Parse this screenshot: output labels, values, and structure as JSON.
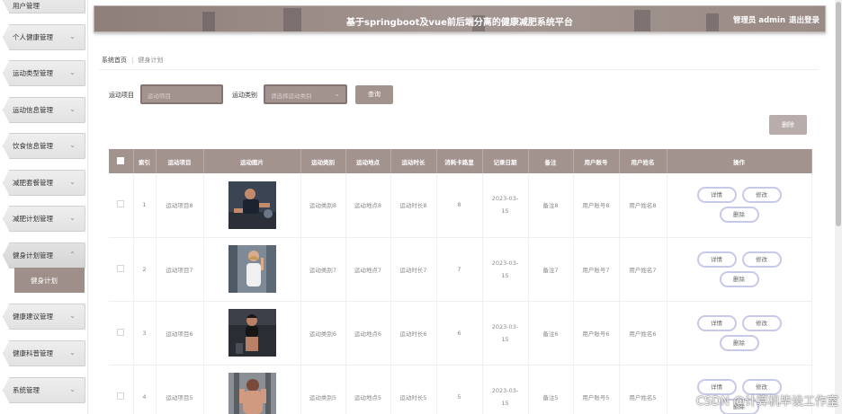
{
  "header": {
    "title": "基于springboot及vue前后端分离的健康减肥系统平台",
    "user": "管理员 admin",
    "logout": "退出登录"
  },
  "sidebar": {
    "items": [
      {
        "label": "用户管理"
      },
      {
        "label": "个人健康管理"
      },
      {
        "label": "运动类型管理"
      },
      {
        "label": "运动信息管理"
      },
      {
        "label": "饮食信息管理"
      },
      {
        "label": "减肥套餐管理"
      },
      {
        "label": "减肥计划管理"
      },
      {
        "label": "健身计划管理"
      },
      {
        "label": "健康建议管理"
      },
      {
        "label": "健康科普管理"
      },
      {
        "label": "系统管理"
      }
    ],
    "submenu": "健身计划"
  },
  "breadcrumb": {
    "home": "系统首页",
    "current": "健身计划"
  },
  "search": {
    "item_label": "运动项目",
    "item_placeholder": "运动项目",
    "type_label": "运动类别",
    "type_placeholder": "请选择运动类别",
    "query_button": "查询"
  },
  "toolbar": {
    "delete_button": "删除"
  },
  "table": {
    "columns": [
      "索引",
      "运动项目",
      "运动图片",
      "运动类别",
      "运动地点",
      "运动时长",
      "消耗卡路里",
      "记录日期",
      "备注",
      "用户账号",
      "用户姓名",
      "操作"
    ],
    "rows": [
      {
        "index": "1",
        "item": "运动项目8",
        "type": "运动类别8",
        "place": "运动地点8",
        "duration": "运动时长8",
        "calories": "8",
        "date": "2023-03-15",
        "note": "备注8",
        "account": "用户账号8",
        "name": "用户姓名8"
      },
      {
        "index": "2",
        "item": "运动项目7",
        "type": "运动类别7",
        "place": "运动地点7",
        "duration": "运动时长7",
        "calories": "7",
        "date": "2023-03-15",
        "note": "备注7",
        "account": "用户账号7",
        "name": "用户姓名7"
      },
      {
        "index": "3",
        "item": "运动项目6",
        "type": "运动类别6",
        "place": "运动地点6",
        "duration": "运动时长6",
        "calories": "6",
        "date": "2023-03-15",
        "note": "备注6",
        "account": "用户账号6",
        "name": "用户姓名6"
      },
      {
        "index": "4",
        "item": "运动项目5",
        "type": "运动类别5",
        "place": "运动地点5",
        "duration": "运动时长5",
        "calories": "5",
        "date": "2023-03-15",
        "note": "备注5",
        "account": "用户账号5",
        "name": "用户姓名5"
      }
    ],
    "actions": {
      "detail": "详情",
      "edit": "修改",
      "delete": "删除"
    }
  },
  "watermark": "CSDN @计算机毕设工作室",
  "colors": {
    "accent": "#a3938f",
    "header": "#9a8b86",
    "op_border": "#c7c9e8"
  }
}
